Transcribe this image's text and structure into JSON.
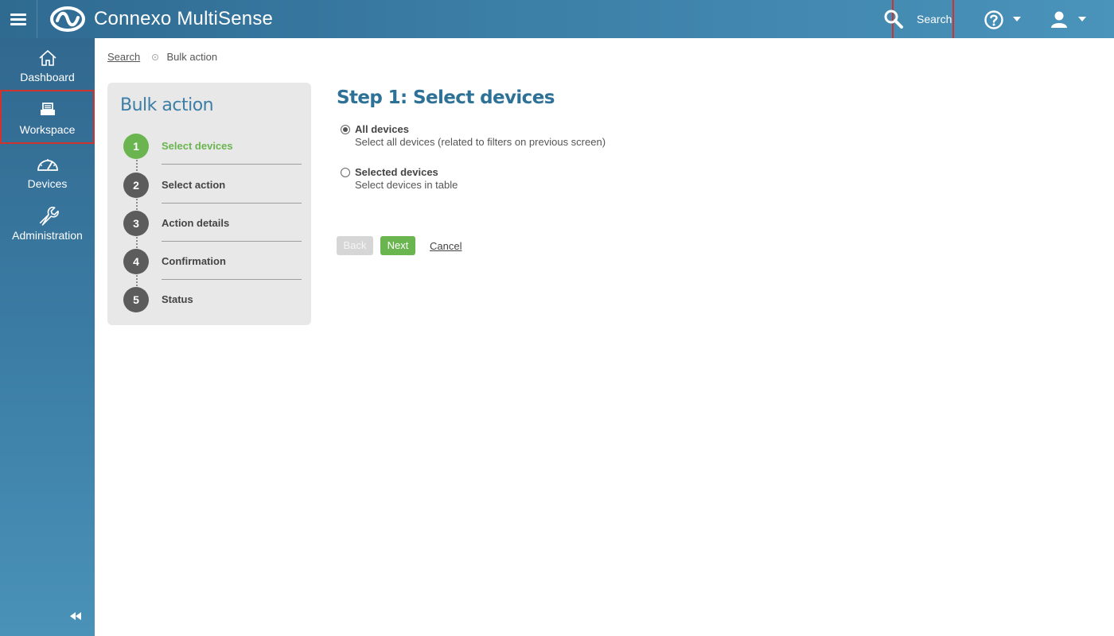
{
  "header": {
    "app_title": "Connexo MultiSense",
    "search_label": "Search",
    "menu_icon": "hamburger-icon",
    "help_icon": "help-icon",
    "user_icon": "user-icon"
  },
  "sidebar": {
    "items": [
      {
        "label": "Dashboard",
        "icon": "home-icon"
      },
      {
        "label": "Workspace",
        "icon": "inbox-icon"
      },
      {
        "label": "Devices",
        "icon": "gauge-icon"
      },
      {
        "label": "Administration",
        "icon": "wrench-icon"
      }
    ],
    "collapse_icon": "double-chevron-left-icon"
  },
  "breadcrumb": {
    "parent": "Search",
    "current": "Bulk action"
  },
  "wizard": {
    "title": "Bulk action",
    "steps": [
      {
        "number": "1",
        "label": "Select devices",
        "active": true
      },
      {
        "number": "2",
        "label": "Select action",
        "active": false
      },
      {
        "number": "3",
        "label": "Action details",
        "active": false
      },
      {
        "number": "4",
        "label": "Confirmation",
        "active": false
      },
      {
        "number": "5",
        "label": "Status",
        "active": false
      }
    ]
  },
  "main": {
    "title": "Step 1: Select devices",
    "options": [
      {
        "label": "All devices",
        "description": "Select all devices (related to filters on previous screen)",
        "checked": true
      },
      {
        "label": "Selected devices",
        "description": "Select devices in table",
        "checked": false
      }
    ],
    "buttons": {
      "back": "Back",
      "next": "Next",
      "cancel": "Cancel"
    }
  },
  "colors": {
    "accent_blue": "#2d7197",
    "active_green": "#6ab54f",
    "highlight_red": "#d0322d"
  }
}
